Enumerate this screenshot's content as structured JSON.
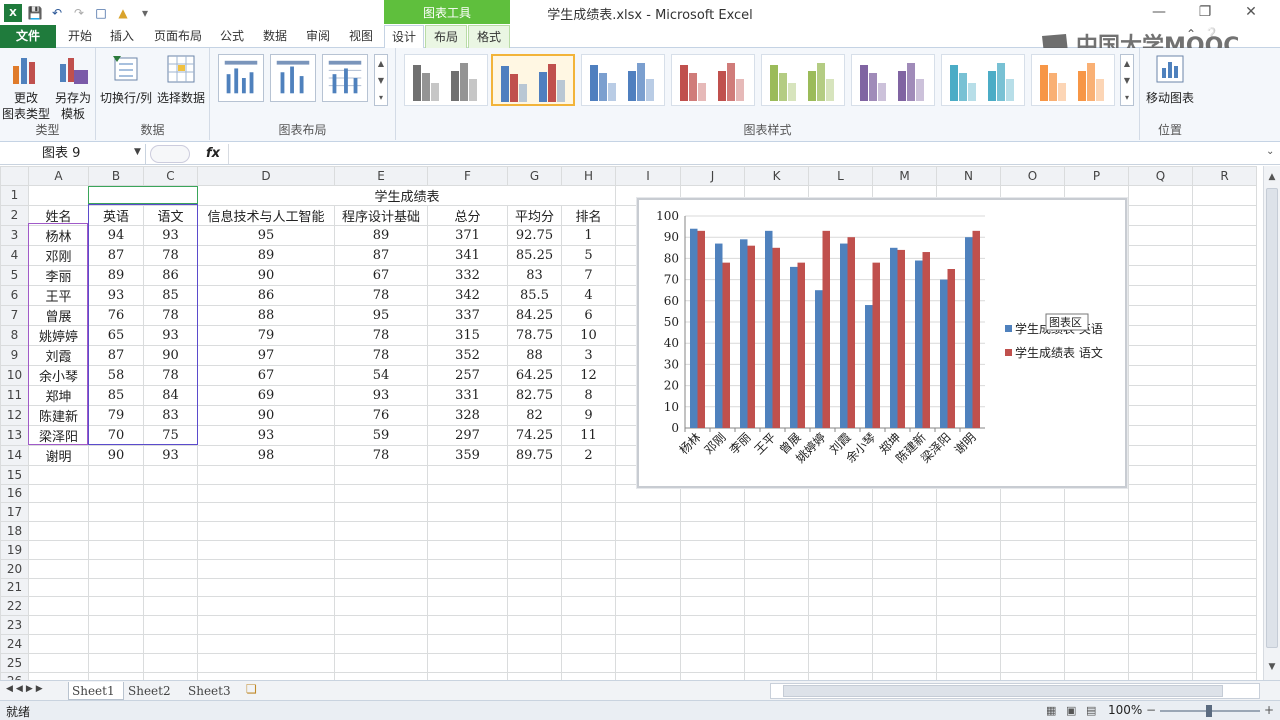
{
  "app": {
    "doc_title": "学生成绩表.xlsx - Microsoft Excel",
    "context_group": "图表工具",
    "logo_text": "中国大学MOOC"
  },
  "tabs": [
    {
      "label": "文件"
    },
    {
      "label": "开始"
    },
    {
      "label": "插入"
    },
    {
      "label": "页面布局"
    },
    {
      "label": "公式"
    },
    {
      "label": "数据"
    },
    {
      "label": "审阅"
    },
    {
      "label": "视图"
    },
    {
      "label": "设计"
    },
    {
      "label": "布局"
    },
    {
      "label": "格式"
    }
  ],
  "ribbon": {
    "change_type": "更改\n图表类型",
    "save_template": "另存为\n模板",
    "switch_rowcol": "切换行/列",
    "select_data": "选择数据",
    "move_chart": "移动图表",
    "groups": [
      "类型",
      "数据",
      "图表布局",
      "图表样式",
      "位置"
    ],
    "style_colors": [
      "#707070",
      "#4f7fbf",
      "#4f7fbf",
      "#c0504d",
      "#9bbb59",
      "#8064a2",
      "#4bacc6",
      "#f79646"
    ]
  },
  "formula": {
    "name_box": "图表 9",
    "fx": "fx",
    "value": ""
  },
  "sheet": {
    "col_headers": [
      "A",
      "B",
      "C",
      "D",
      "E",
      "F",
      "G",
      "H",
      "I",
      "J",
      "K",
      "L",
      "M",
      "N",
      "O",
      "P",
      "Q",
      "R"
    ],
    "title": "学生成绩表",
    "headers": [
      "姓名",
      "英语",
      "语文",
      "信息技术与人工智能",
      "程序设计基础",
      "总分",
      "平均分",
      "排名"
    ],
    "rows": [
      [
        "杨林",
        "94",
        "93",
        "95",
        "89",
        "371",
        "92.75",
        "1"
      ],
      [
        "邓刚",
        "87",
        "78",
        "89",
        "87",
        "341",
        "85.25",
        "5"
      ],
      [
        "李丽",
        "89",
        "86",
        "90",
        "67",
        "332",
        "83",
        "7"
      ],
      [
        "王平",
        "93",
        "85",
        "86",
        "78",
        "342",
        "85.5",
        "4"
      ],
      [
        "曾展",
        "76",
        "78",
        "88",
        "95",
        "337",
        "84.25",
        "6"
      ],
      [
        "姚婷婷",
        "65",
        "93",
        "79",
        "78",
        "315",
        "78.75",
        "10"
      ],
      [
        "刘霞",
        "87",
        "90",
        "97",
        "78",
        "352",
        "88",
        "3"
      ],
      [
        "余小琴",
        "58",
        "78",
        "67",
        "54",
        "257",
        "64.25",
        "12"
      ],
      [
        "郑坤",
        "85",
        "84",
        "69",
        "93",
        "331",
        "82.75",
        "8"
      ],
      [
        "陈建新",
        "79",
        "83",
        "90",
        "76",
        "328",
        "82",
        "9"
      ],
      [
        "梁泽阳",
        "70",
        "75",
        "93",
        "59",
        "297",
        "74.25",
        "11"
      ],
      [
        "谢明",
        "90",
        "93",
        "98",
        "78",
        "359",
        "89.75",
        "2"
      ]
    ],
    "total_rows": 27
  },
  "chart_data": {
    "type": "bar",
    "categories": [
      "杨林",
      "邓刚",
      "李丽",
      "王平",
      "曾展",
      "姚婷婷",
      "刘霞",
      "余小琴",
      "郑坤",
      "陈建新",
      "梁泽阳",
      "谢明"
    ],
    "series": [
      {
        "name": "学生成绩表 英语",
        "values": [
          94,
          87,
          89,
          93,
          76,
          65,
          87,
          58,
          85,
          79,
          70,
          90
        ],
        "color": "#4f81bd"
      },
      {
        "name": "学生成绩表 语文",
        "values": [
          93,
          78,
          86,
          85,
          78,
          93,
          90,
          78,
          84,
          83,
          75,
          93
        ],
        "color": "#c0504d"
      }
    ],
    "ylim": [
      0,
      100
    ],
    "yticks": [
      0,
      10,
      20,
      30,
      40,
      50,
      60,
      70,
      80,
      90,
      100
    ],
    "grid": true,
    "legend": "right",
    "tooltip": "图表区"
  },
  "sheet_tabs": [
    "Sheet1",
    "Sheet2",
    "Sheet3"
  ],
  "status": {
    "ready": "就绪",
    "zoom": "100%"
  }
}
